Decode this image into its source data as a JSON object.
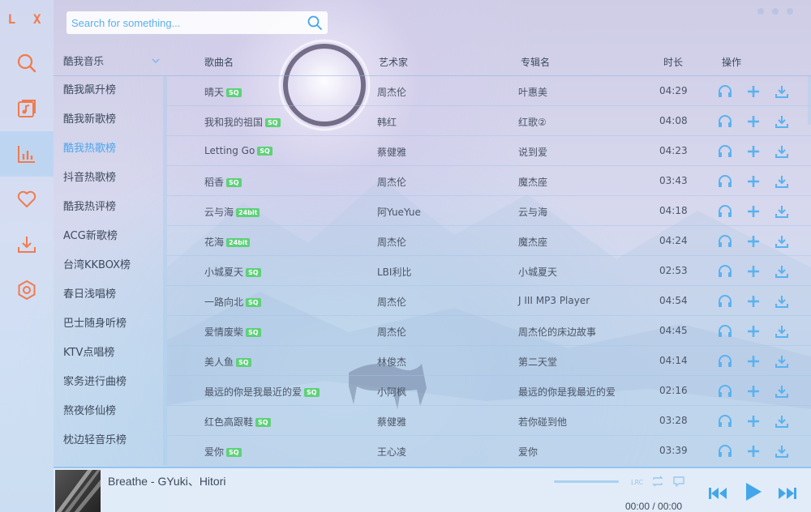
{
  "app": {
    "logo": "L X"
  },
  "colors": {
    "accent": "#44a6ea",
    "orange": "#f07b4e",
    "badge": "#5fd079"
  },
  "nav": [
    {
      "name": "search-icon",
      "active": false
    },
    {
      "name": "music-list-icon",
      "active": false
    },
    {
      "name": "leaderboard-icon",
      "active": true
    },
    {
      "name": "heart-icon",
      "active": false
    },
    {
      "name": "download-icon",
      "active": false
    },
    {
      "name": "settings-icon",
      "active": false
    }
  ],
  "search": {
    "placeholder": "Search for something..."
  },
  "source": {
    "selected": "酷我音乐",
    "items": [
      "酷我飙升榜",
      "酷我新歌榜",
      "酷我热歌榜",
      "抖音热歌榜",
      "酷我热评榜",
      "ACG新歌榜",
      "台湾KKBOX榜",
      "春日浅唱榜",
      "巴士随身听榜",
      "KTV点唱榜",
      "家务进行曲榜",
      "熬夜修仙榜",
      "枕边轻音乐榜"
    ],
    "active_index": 2
  },
  "table": {
    "headers": {
      "name": "歌曲名",
      "artist": "艺术家",
      "album": "专辑名",
      "duration": "时长",
      "ops": "操作"
    },
    "rows": [
      {
        "name": "晴天",
        "badge": "SQ",
        "artist": "周杰伦",
        "album": "叶惠美",
        "duration": "04:29"
      },
      {
        "name": "我和我的祖国",
        "badge": "SQ",
        "artist": "韩红",
        "album": "红歌②",
        "duration": "04:08"
      },
      {
        "name": "Letting Go",
        "badge": "SQ",
        "artist": "蔡健雅",
        "album": "说到爱",
        "duration": "04:23"
      },
      {
        "name": "稻香",
        "badge": "SQ",
        "artist": "周杰伦",
        "album": "魔杰座",
        "duration": "03:43"
      },
      {
        "name": "云与海",
        "badge": "24bit",
        "artist": "阿YueYue",
        "album": "云与海",
        "duration": "04:18"
      },
      {
        "name": "花海",
        "badge": "24bit",
        "artist": "周杰伦",
        "album": "魔杰座",
        "duration": "04:24"
      },
      {
        "name": "小城夏天",
        "badge": "SQ",
        "artist": "LBI利比",
        "album": "小城夏天",
        "duration": "02:53"
      },
      {
        "name": "一路向北",
        "badge": "SQ",
        "artist": "周杰伦",
        "album": "J III MP3 Player",
        "duration": "04:54"
      },
      {
        "name": "爱情废柴",
        "badge": "SQ",
        "artist": "周杰伦",
        "album": "周杰伦的床边故事",
        "duration": "04:45"
      },
      {
        "name": "美人鱼",
        "badge": "SQ",
        "artist": "林俊杰",
        "album": "第二天堂",
        "duration": "04:14"
      },
      {
        "name": "最远的你是我最近的爱",
        "badge": "SQ",
        "artist": "小阿枫",
        "album": "最远的你是我最近的爱",
        "duration": "02:16"
      },
      {
        "name": "红色高跟鞋",
        "badge": "SQ",
        "artist": "蔡健雅",
        "album": "若你碰到他",
        "duration": "03:28"
      },
      {
        "name": "爱你",
        "badge": "SQ",
        "artist": "王心凌",
        "album": "爱你",
        "duration": "03:39"
      }
    ]
  },
  "player": {
    "title": "Breathe - GYuki、Hitori",
    "time": "00:00 / 00:00",
    "progress": 0
  }
}
